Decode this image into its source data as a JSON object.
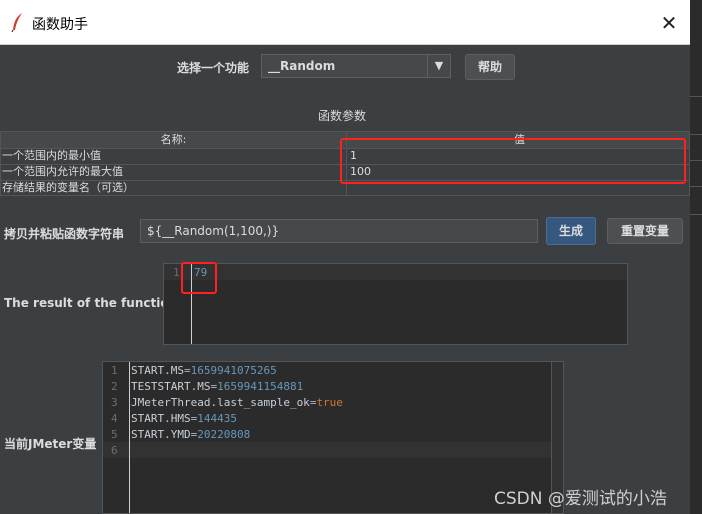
{
  "window": {
    "title": "函数助手",
    "close_symbol": "✕"
  },
  "selector": {
    "label": "选择一个功能",
    "selected_function": "__Random",
    "help_button": "帮助"
  },
  "params": {
    "section_title": "函数参数",
    "columns": [
      "名称:",
      "值"
    ],
    "rows": [
      {
        "name": "一个范围内的最小值",
        "value": "1"
      },
      {
        "name": "一个范围内允许的最大值",
        "value": "100"
      },
      {
        "name": "存储结果的变量名（可选）",
        "value": ""
      }
    ]
  },
  "copy_row": {
    "label": "拷贝并粘贴函数字符串",
    "value": "${__Random(1,100,)}",
    "generate_button": "生成",
    "reset_button": "重置变量"
  },
  "result": {
    "label": "The result of the function is",
    "line_numbers": [
      "1"
    ],
    "value": "79"
  },
  "variables": {
    "label": "当前JMeter变量",
    "line_numbers": [
      "1",
      "2",
      "3",
      "4",
      "5",
      "6"
    ],
    "lines": [
      {
        "key": "START.MS",
        "value": "1659941075265"
      },
      {
        "key": "TESTSTART.MS",
        "value": "1659941154881"
      },
      {
        "key": "JMeterThread.last_sample_ok",
        "value": "true"
      },
      {
        "key": "START.HMS",
        "value": "144435"
      },
      {
        "key": "START.YMD",
        "value": "20220808"
      }
    ]
  },
  "watermark": "CSDN @爱测试的小浩",
  "colors": {
    "highlight": "#ff2020",
    "background": "#3c3f41",
    "number": "#6897bb",
    "keyword": "#cc7832"
  }
}
